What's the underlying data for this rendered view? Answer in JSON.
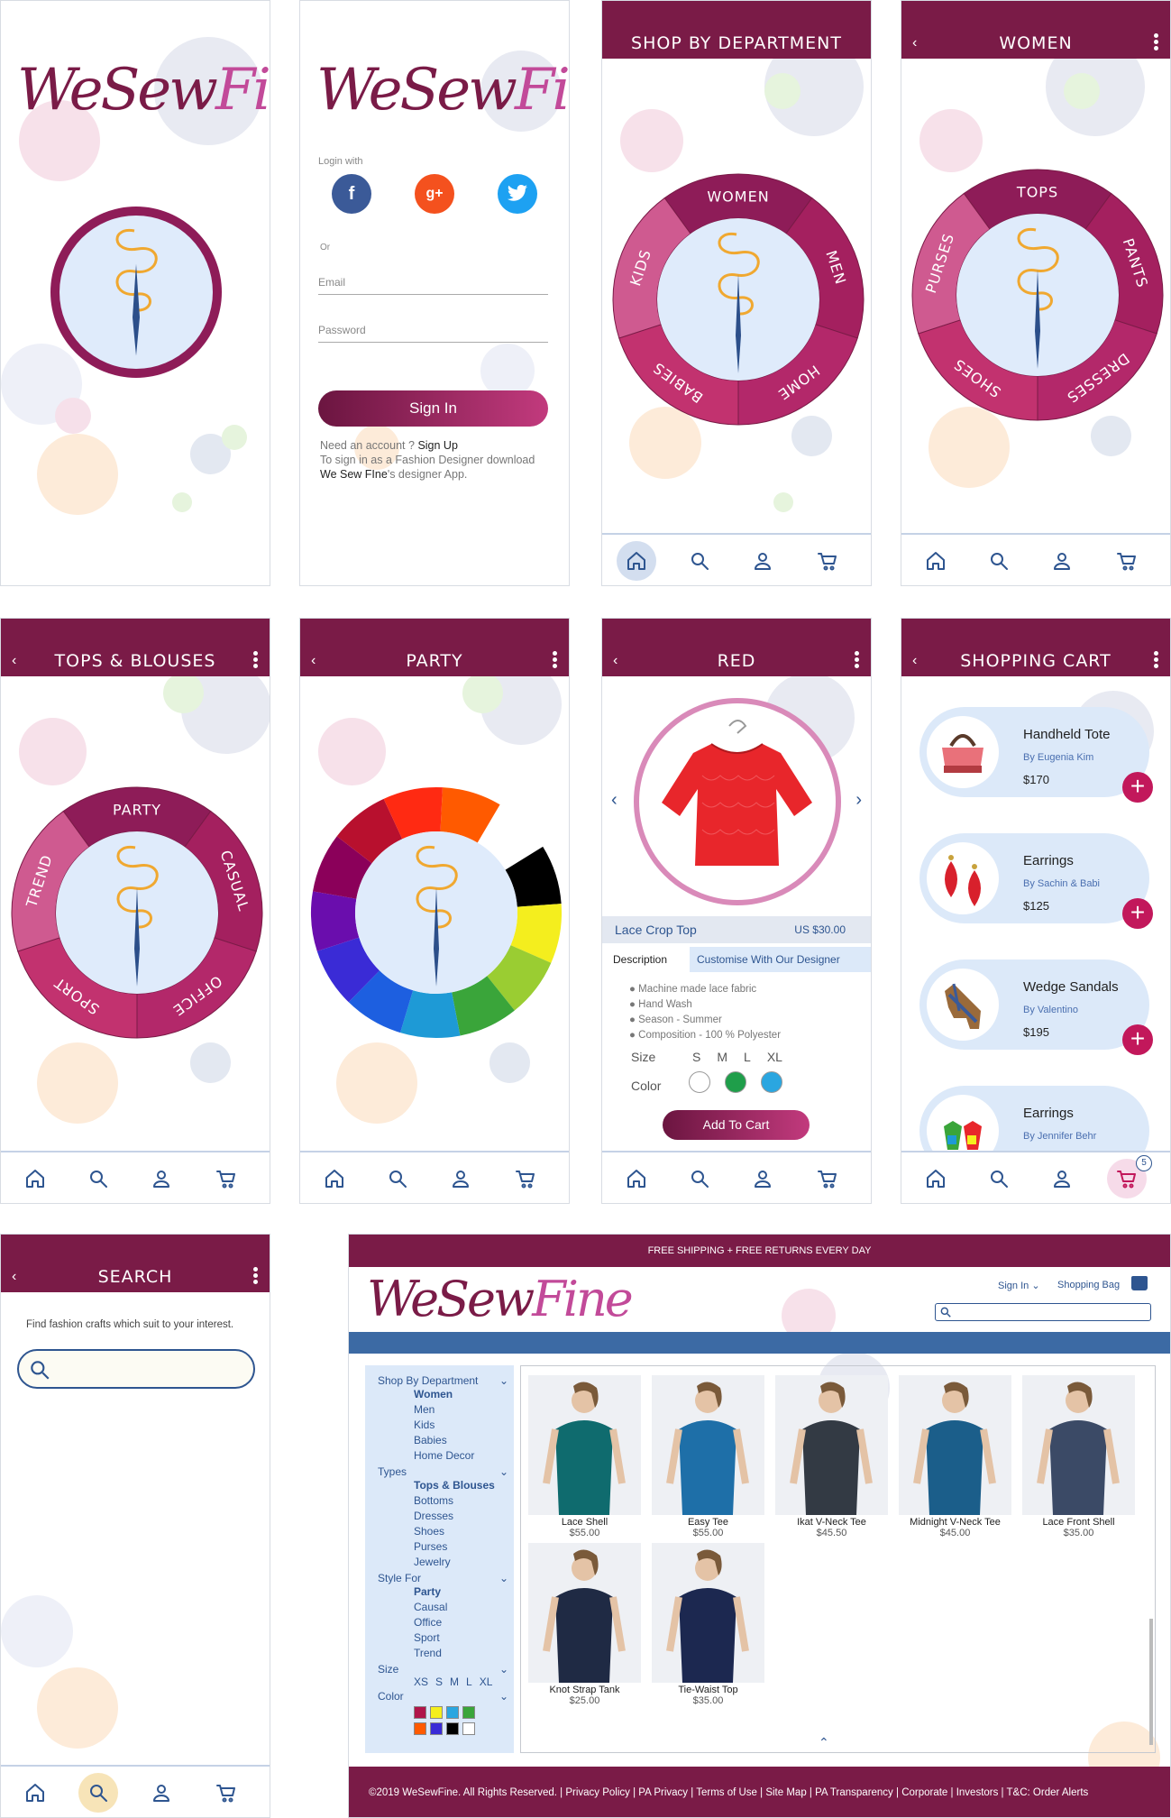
{
  "brand": {
    "logo_part1": "WeSew",
    "logo_part2": "Fine"
  },
  "colors": {
    "primary": "#7a1b47",
    "accent": "#c2185b",
    "nav_icon": "#2e5590",
    "light_blue": "#dce9f9"
  },
  "login": {
    "login_with": "Login with",
    "or": "Or",
    "email_placeholder": "Email",
    "password_placeholder": "Password",
    "sign_in": "Sign In",
    "need_account": "Need an account ?",
    "sign_up": "Sign Up",
    "designer_line1": "To sign in as a Fashion Designer download",
    "designer_app_name": "We Sew FIne",
    "designer_line2": "'s designer App.",
    "social": [
      "facebook-icon",
      "google-plus-icon",
      "twitter-icon"
    ]
  },
  "shop_dept": {
    "title": "SHOP BY DEPARTMENT",
    "segments": [
      "WOMEN",
      "MEN",
      "HOME",
      "BABIES",
      "KIDS"
    ]
  },
  "women": {
    "title": "WOMEN",
    "segments": [
      "TOPS",
      "PANTS",
      "DRESSES",
      "SHOES",
      "PURSES"
    ]
  },
  "tops": {
    "title": "TOPS & BLOUSES",
    "segments": [
      "PARTY",
      "CASUAL",
      "OFFICE",
      "SPORT",
      "TREND"
    ]
  },
  "party": {
    "title": "PARTY",
    "colors": [
      "#ff5a00",
      "#ffffff",
      "#000000",
      "#f4ee1e",
      "#9acd32",
      "#3aa53a",
      "#1e9ad6",
      "#1d5fe0",
      "#3a2bd6",
      "#6a0dad",
      "#8b005a",
      "#b8102e",
      "#ff2a12"
    ]
  },
  "red": {
    "title": "RED",
    "product_name": "Lace Crop Top",
    "price": "US $30.00",
    "tab_description": "Description",
    "tab_customise": "Customise With Our Designer",
    "bullets": [
      "Machine made lace fabric",
      "Hand Wash",
      "Season - Summer",
      "Composition - 100 % Polyester"
    ],
    "size_label": "Size",
    "sizes": [
      "S",
      "M",
      "L",
      "XL"
    ],
    "color_label": "Color",
    "color_options": [
      "#ffffff",
      "#1f9e4a",
      "#2aa6e0"
    ],
    "add_to_cart": "Add To Cart"
  },
  "cart": {
    "title": "SHOPPING CART",
    "badge": "5",
    "items": [
      {
        "name": "Handheld Tote",
        "by": "By Eugenia Kim",
        "price": "$170"
      },
      {
        "name": "Earrings",
        "by": "By Sachin & Babi",
        "price": "$125"
      },
      {
        "name": "Wedge Sandals",
        "by": "By Valentino",
        "price": "$195"
      },
      {
        "name": "Earrings",
        "by": "By Jennifer Behr",
        "price": ""
      }
    ]
  },
  "search": {
    "title": "SEARCH",
    "hint": "Find fashion crafts which suit to your interest.",
    "placeholder": ""
  },
  "web": {
    "banner": "FREE SHIPPING + FREE RETURNS EVERY DAY",
    "sign_in": "Sign In",
    "shopping_bag": "Shopping Bag",
    "search_placeholder": "",
    "sidebar": {
      "dept_label": "Shop By Department",
      "dept": [
        "Women",
        "Men",
        "Kids",
        "Babies",
        "Home Decor"
      ],
      "types_label": "Types",
      "types": [
        "Tops & Blouses",
        "Bottoms",
        "Dresses",
        "Shoes",
        "Purses",
        "Jewelry"
      ],
      "style_label": "Style For",
      "styles": [
        "Party",
        "Causal",
        "Office",
        "Sport",
        "Trend"
      ],
      "size_label": "Size",
      "sizes": [
        "XS",
        "S",
        "M",
        "L",
        "XL"
      ],
      "color_label": "Color",
      "colors": [
        "#b0154a",
        "#f5ef1d",
        "#2aa6e0",
        "#3aa53a",
        "#ff5a00",
        "#3a2bd6",
        "#000000",
        "#ffffff"
      ]
    },
    "products": [
      {
        "name": "Lace Shell",
        "price": "$55.00",
        "color": "#0f6b6e"
      },
      {
        "name": "Easy Tee",
        "price": "$55.00",
        "color": "#1e6fa8"
      },
      {
        "name": "Ikat V-Neck Tee",
        "price": "$45.50",
        "color": "#333a44"
      },
      {
        "name": "Midnight V-Neck Tee",
        "price": "$45.00",
        "color": "#1b5e8a"
      },
      {
        "name": "Lace Front Shell",
        "price": "$35.00",
        "color": "#3b4a66"
      },
      {
        "name": "Knot Strap Tank",
        "price": "$25.00",
        "color": "#1f2a44"
      },
      {
        "name": "Tie-Waist Top",
        "price": "$35.00",
        "color": "#1c2850"
      }
    ],
    "footer": "©2019 WeSewFine. All Rights Reserved. | Privacy Policy | PA Privacy | Terms of Use | Site Map | PA Transparency | Corporate | Investors | T&C: Order Alerts"
  }
}
